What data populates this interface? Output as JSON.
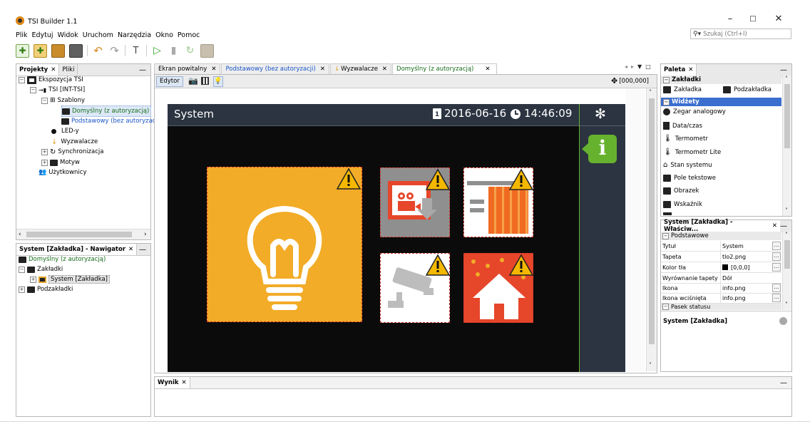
{
  "app": {
    "title": "TSI Builder 1.1",
    "window_controls": [
      "–",
      "□",
      "✕"
    ]
  },
  "menu": [
    "Plik",
    "Edytuj",
    "Widok",
    "Uruchom",
    "Narzędzia",
    "Okno",
    "Pomoc"
  ],
  "search": {
    "placeholder": "Szukaj (Ctrl+I)"
  },
  "projects_panel": {
    "tabs": [
      "Projekty",
      "Pliki"
    ],
    "tree": [
      {
        "label": "Ekspozycja TSI",
        "level": 0
      },
      {
        "label": "TSI [INT-TSI]",
        "level": 1
      },
      {
        "label": "Szablony",
        "level": 2
      },
      {
        "label": "Domyślny (z autoryzacją)",
        "level": 3
      },
      {
        "label": "Podstawowy (bez autoryzacji)",
        "level": 3
      },
      {
        "label": "LED-y",
        "level": 2
      },
      {
        "label": "Wyzwalacze",
        "level": 2
      },
      {
        "label": "Synchronizacja",
        "level": 2
      },
      {
        "label": "Motyw",
        "level": 2
      },
      {
        "label": "Użytkownicy",
        "level": 1
      }
    ]
  },
  "navigator_panel": {
    "title": "System [Zakładka] - Nawigator",
    "tree": [
      {
        "label": "Domyślny (z autoryzacją)"
      },
      {
        "label": "Zakładki"
      },
      {
        "label": "System [Zakładka]"
      },
      {
        "label": "Podzakładki"
      }
    ]
  },
  "editor_tabs": [
    {
      "label": "Ekran powitalny"
    },
    {
      "label": "Podstawowy (bez autoryzacji)"
    },
    {
      "label": "Wyzwalacze"
    },
    {
      "label": "Domyślny (z autoryzacją)"
    }
  ],
  "editor": {
    "mode_tab": "Edytor",
    "coords": "[000,000]"
  },
  "screen": {
    "title": "System",
    "date": "2016-06-16",
    "time": "14:46:09",
    "info_letter": "i"
  },
  "colors": {
    "screen_bg": "#0b0b0b",
    "header_bg": "#2b3440",
    "sidebar_bg": "#2b3440",
    "accent_green": "#66b22e",
    "tile_orange": "#f2ac28",
    "tile_red": "#e6462a",
    "warning": "#f5b800"
  },
  "output_panel": {
    "tab": "Wynik"
  },
  "palette": {
    "title": "Paleta",
    "sections": [
      {
        "label": "Zakładki",
        "items": [
          "Zakładka",
          "Podzakładka"
        ]
      },
      {
        "label": "Widżety",
        "items": [
          "Zegar analogowy",
          "Data/czas",
          "Termometr",
          "Termometr Lite",
          "Stan systemu",
          "Pole tekstowe",
          "Obrazek",
          "Wskaźnik"
        ]
      }
    ]
  },
  "properties": {
    "title": "System [Zakładka] - Właściw...",
    "group": "Podstawowe",
    "rows": [
      {
        "key": "Tytuł",
        "value": "System"
      },
      {
        "key": "Tapeta",
        "value": "tlo2.png"
      },
      {
        "key": "Kolor tła",
        "value": "[0,0,0]"
      },
      {
        "key": "Wyrównanie tapety",
        "value": "Dół"
      },
      {
        "key": "Ikona",
        "value": "info.png"
      },
      {
        "key": "Ikona wciśnięta",
        "value": "info.png"
      }
    ],
    "next_group": "Pasek statusu",
    "footer": "System [Zakładka]"
  }
}
